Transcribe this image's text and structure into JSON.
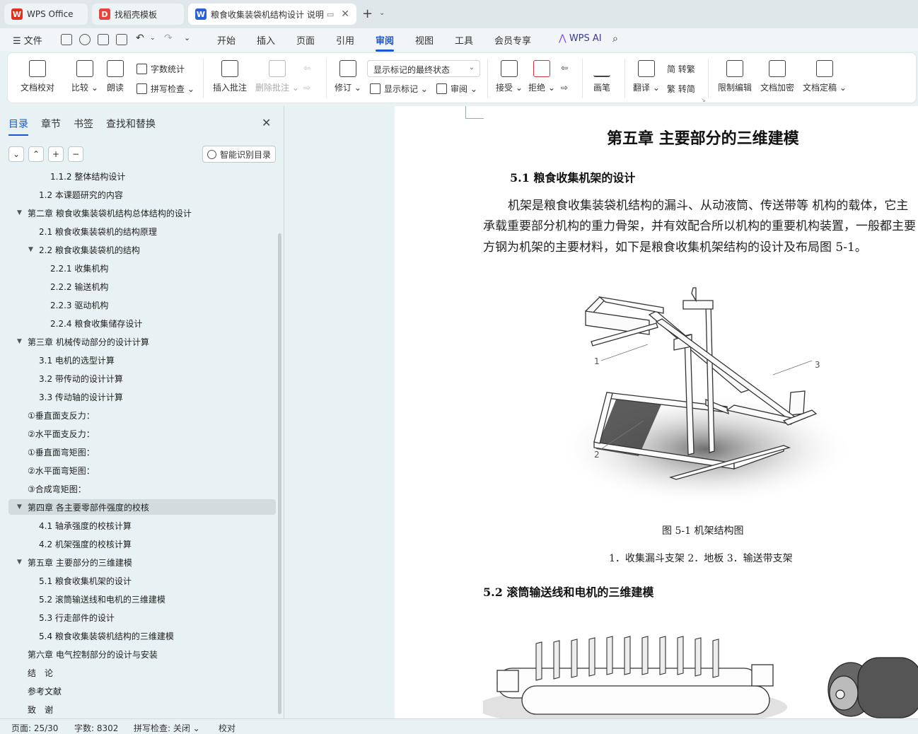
{
  "tabs": [
    {
      "label": "WPS Office",
      "icon": "wps-logo-icon"
    },
    {
      "label": "找稻壳模板",
      "icon": "docer-icon"
    },
    {
      "label": "粮食收集装袋机结构设计 说明",
      "icon": "writer-doc-icon"
    }
  ],
  "menu": {
    "file_label": "文件",
    "items": [
      "开始",
      "插入",
      "页面",
      "引用",
      "审阅",
      "视图",
      "工具",
      "会员专享"
    ],
    "active": "审阅",
    "wps_ai": "WPS AI"
  },
  "ribbon": {
    "doc_check": "文档校对",
    "compare": "比较",
    "read_aloud": "朗读",
    "word_count": "字数统计",
    "spell_check": "拼写检查",
    "insert_comment": "插入批注",
    "delete_comment": "删除批注",
    "revise": "修订",
    "markup_state": "显示标记的最终状态",
    "show_markup": "显示标记",
    "review_pane": "审阅",
    "accept": "接受",
    "reject": "拒绝",
    "ink": "画笔",
    "translate": "翻译",
    "to_traditional": "简 转繁",
    "to_simplified": "繁 转简",
    "restrict_edit": "限制编辑",
    "encrypt": "文档加密",
    "finalize": "文档定稿"
  },
  "panel": {
    "tabs": [
      "目录",
      "章节",
      "书签",
      "查找和替换"
    ],
    "active_tab": "目录",
    "smart_toc": "智能识别目录"
  },
  "toc": [
    {
      "text": "1.1.2 整体结构设计",
      "level": 3,
      "arrow": false
    },
    {
      "text": "1.2 本课题研究的内容",
      "level": 2,
      "arrow": false
    },
    {
      "text": "第二章 粮食收集装袋机结构总体结构的设计",
      "level": 1,
      "arrow": true
    },
    {
      "text": "2.1 粮食收集装袋机的结构原理",
      "level": 2,
      "arrow": false
    },
    {
      "text": "2.2 粮食收集装袋机的结构",
      "level": 2,
      "arrow": true
    },
    {
      "text": "2.2.1   收集机构",
      "level": 3,
      "arrow": false
    },
    {
      "text": "2.2.2   输送机构",
      "level": 3,
      "arrow": false
    },
    {
      "text": "2.2.3  驱动机构",
      "level": 3,
      "arrow": false
    },
    {
      "text": "2.2.4  粮食收集储存设计",
      "level": 3,
      "arrow": false
    },
    {
      "text": "第三章 机械传动部分的设计计算",
      "level": 1,
      "arrow": true
    },
    {
      "text": "3.1 电机的选型计算",
      "level": 2,
      "arrow": false
    },
    {
      "text": "3.2 带传动的设计计算",
      "level": 2,
      "arrow": false
    },
    {
      "text": "3.3 传动轴的设计计算",
      "level": 2,
      "arrow": false
    },
    {
      "text": "①垂直面支反力：",
      "level": 1,
      "arrow": false
    },
    {
      "text": "②水平面支反力：",
      "level": 1,
      "arrow": false
    },
    {
      "text": "①垂直面弯矩图：",
      "level": 1,
      "arrow": false
    },
    {
      "text": "②水平面弯矩图：",
      "level": 1,
      "arrow": false
    },
    {
      "text": "③合成弯矩图：",
      "level": 1,
      "arrow": false
    },
    {
      "text": "第四章 各主要零部件强度的校核",
      "level": 1,
      "arrow": true,
      "selected": true
    },
    {
      "text": "4.1 轴承强度的校核计算",
      "level": 2,
      "arrow": false
    },
    {
      "text": "4.2 机架强度的校核计算",
      "level": 2,
      "arrow": false
    },
    {
      "text": "第五章 主要部分的三维建模",
      "level": 1,
      "arrow": true
    },
    {
      "text": "5.1 粮食收集机架的设计",
      "level": 2,
      "arrow": false
    },
    {
      "text": "5.2 滚筒输送线和电机的三维建模",
      "level": 2,
      "arrow": false
    },
    {
      "text": "5.3 行走部件的设计",
      "level": 2,
      "arrow": false
    },
    {
      "text": "5.4 粮食收集装袋机结构的三维建模",
      "level": 2,
      "arrow": false
    },
    {
      "text": "第六章 电气控制部分的设计与安装",
      "level": 1,
      "arrow": false
    },
    {
      "text": "结　论",
      "level": 1,
      "arrow": false
    },
    {
      "text": "参考文献",
      "level": 1,
      "arrow": false
    },
    {
      "text": "致　谢",
      "level": 1,
      "arrow": false
    }
  ],
  "doc": {
    "chapter_title": "第五章  主要部分的三维建模",
    "section1": "5.1  粮食收集机架的设计",
    "para": [
      "机架是粮食收集装袋机结构的漏斗、从动液筒、传送带等  机构的载体，它主",
      "承载重要部分机构的重力骨架，并有效配合所以机构的重要机构装置，一般都主要",
      "方钢为机架的主要材料，如下是粮食收集机架结构的设计及布局图 5-1。"
    ],
    "fig_labels": [
      "1",
      "2",
      "3"
    ],
    "fig_caption": "图 5-1  机架结构图",
    "fig_legend": "1．收集漏斗支架  2．地板  3．输送带支架",
    "section2": "5.2  滚筒输送线和电机的三维建模"
  },
  "status": {
    "page": "页面: 25/30",
    "words": "字数: 8302",
    "spell": "拼写检查: 关闭",
    "proof": "校对"
  },
  "colors": {
    "accent": "#1a56d6",
    "panel_bg": "#e8f1f3"
  }
}
